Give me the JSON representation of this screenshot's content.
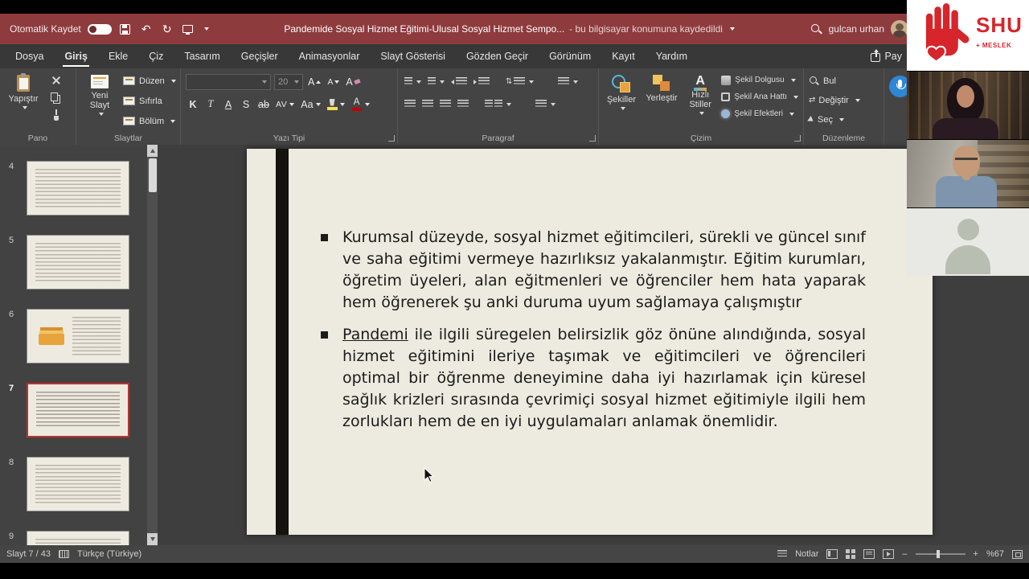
{
  "titlebar": {
    "autosave_label": "Otomatik Kaydet",
    "document_title": "Pandemide Sosyal Hizmet Eğitimi-Ulusal Sosyal Hizmet Sempo...",
    "save_status": "- bu bilgisayar konumuna kaydedildi",
    "user_name": "gulcan urhan"
  },
  "tabs": {
    "items": [
      "Dosya",
      "Giriş",
      "Ekle",
      "Çiz",
      "Tasarım",
      "Geçişler",
      "Animasyonlar",
      "Slayt Gösterisi",
      "Gözden Geçir",
      "Görünüm",
      "Kayıt",
      "Yardım"
    ],
    "active": "Giriş",
    "share_label": "Pay"
  },
  "ribbon": {
    "clipboard": {
      "paste": "Yapıştır",
      "label": "Pano"
    },
    "slides": {
      "new_slide": "Yeni Slayt",
      "layout": "Düzen",
      "reset": "Sıfırla",
      "section": "Bölüm",
      "label": "Slaytlar"
    },
    "font": {
      "size": "20",
      "bold": "K",
      "italic": "T",
      "underline": "A",
      "shadow": "S",
      "strikethrough": "ab",
      "spacing": "AV",
      "case": "Aa",
      "label": "Yazı Tipi"
    },
    "paragraph": {
      "label": "Paragraf"
    },
    "drawing": {
      "shapes": "Şekiller",
      "arrange": "Yerleştir",
      "quick_styles": "Hızlı Stiller",
      "shape_fill": "Şekil Dolgusu",
      "shape_outline": "Şekil Ana Hattı",
      "shape_effects": "Şekil Efektleri",
      "label": "Çizim"
    },
    "editing": {
      "find": "Bul",
      "replace": "Değiştir",
      "select": "Seç",
      "label": "Düzenleme"
    }
  },
  "icons": {
    "letter_a": "A",
    "undo": "↶",
    "redo": "↻",
    "zoom_minus": "–",
    "zoom_plus": "+"
  },
  "thumbnails": [
    {
      "number": "4"
    },
    {
      "number": "5"
    },
    {
      "number": "6",
      "art": true
    },
    {
      "number": "7",
      "selected": true
    },
    {
      "number": "8"
    },
    {
      "number": "9"
    }
  ],
  "slide": {
    "bullet1": "Kurumsal düzeyde, sosyal hizmet eğitimcileri, sürekli ve güncel sınıf ve saha eğitimi vermeye hazırlıksız yakalanmıştır. Eğitim kurumları, öğretim üyeleri, alan eğitmenleri ve öğrenciler hem hata yaparak hem öğrenerek şu anki duruma uyum sağlamaya çalışmıştır",
    "bullet2_lead": "Pandemi",
    "bullet2_rest": " ile ilgili süregelen belirsizlik göz önüne alındığında, sosyal hizmet eğitimini ileriye taşımak ve eğitimcileri ve öğrencileri optimal bir öğrenme deneyimine daha iyi hazırlamak için küresel sağlık krizleri sırasında çevrimiçi sosyal hizmet eğitimiyle ilgili hem zorlukları hem de en iyi uygulamaları anlamak önemlidir."
  },
  "statusbar": {
    "slide_counter": "Slayt 7 / 43",
    "language": "Türkçe (Türkiye)",
    "notes_label": "Notlar",
    "zoom_level": "%67"
  },
  "meeting": {
    "logo_text": "SHU",
    "logo_subtext": "+ MESLEK"
  },
  "colors": {
    "titlebar": "#8e3b3e",
    "slide_background": "#edeadf",
    "thumbnail_selected_border": "#b8342f",
    "logo_red": "#d6252b"
  }
}
